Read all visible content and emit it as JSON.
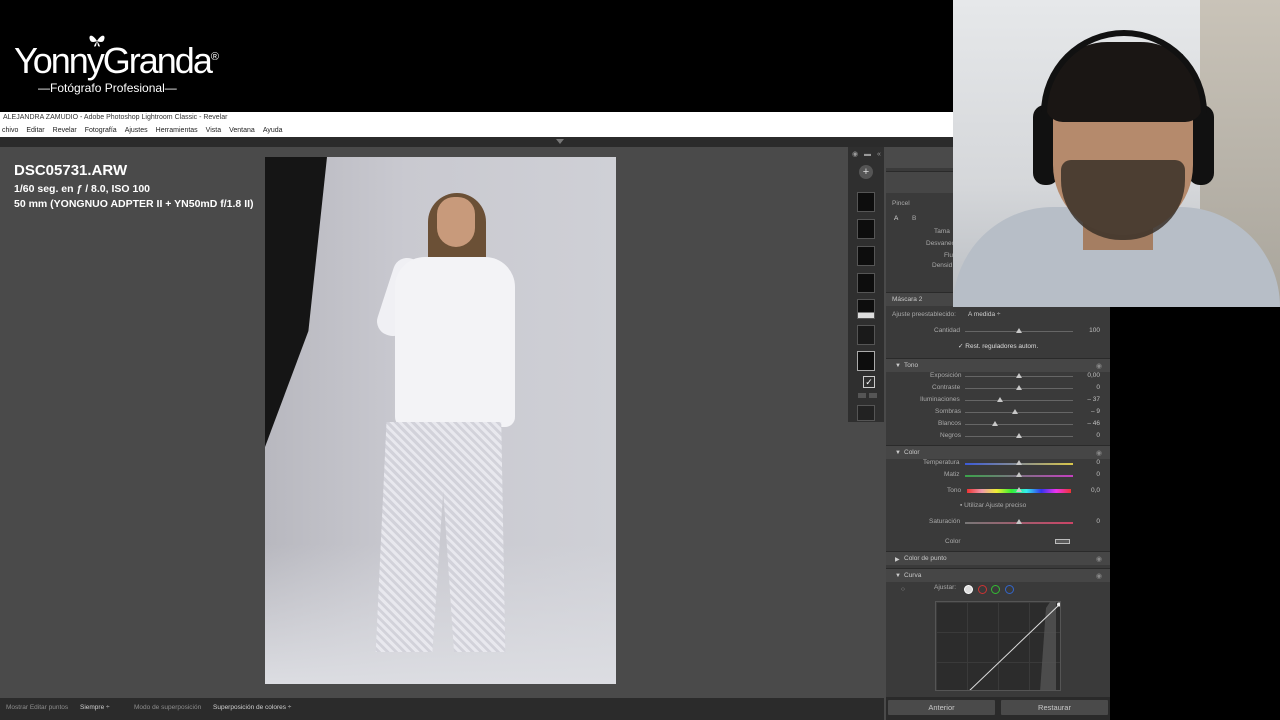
{
  "brand": {
    "name": "YonnyGranda",
    "reg": "®",
    "subtitle": "—Fotógrafo Profesional—"
  },
  "window": {
    "title": "ALEJANDRA ZAMUDIO - Adobe Photoshop Lightroom Classic - Revelar"
  },
  "menu": [
    "chivo",
    "Editar",
    "Revelar",
    "Fotografía",
    "Ajustes",
    "Herramientas",
    "Vista",
    "Ventana",
    "Ayuda"
  ],
  "photo_info": {
    "filename": "DSC05731.ARW",
    "exposure": "1/60 seg. en ƒ / 8.0, ISO 100",
    "lens": "50 mm (YONGNUO ADPTER II + YN50mD f/1.8 II)"
  },
  "panel": {
    "brush_label": "Pincel",
    "brush_a": "A",
    "brush_b": "B",
    "brush_rows": [
      "Tama",
      "Desvanec",
      "Flu",
      "Densid"
    ],
    "mask_label": "Máscara 2",
    "preset_label": "Ajuste preestablecido:",
    "preset_value": "A medida ÷",
    "amount_label": "Cantidad",
    "amount_value": "100",
    "reset_label": "Rest. reguladores autom.",
    "tone_section": "Tono",
    "tone": [
      {
        "label": "Exposición",
        "value": "0,00",
        "pos": 0.5
      },
      {
        "label": "Contraste",
        "value": "0",
        "pos": 0.5
      },
      {
        "label": "Iluminaciones",
        "value": "– 37",
        "pos": 0.32
      },
      {
        "label": "Sombras",
        "value": "– 9",
        "pos": 0.46
      },
      {
        "label": "Blancos",
        "value": "– 46",
        "pos": 0.28
      },
      {
        "label": "Negros",
        "value": "0",
        "pos": 0.5
      }
    ],
    "color_section": "Color",
    "temp_label": "Temperatura",
    "temp_value": "0",
    "tint_label": "Matiz",
    "tint_value": "0",
    "hue_label": "Tono",
    "hue_value": "0,0",
    "fine_adjust_label": "Utilizar Ajuste preciso",
    "sat_label": "Saturación",
    "sat_value": "0",
    "color_label": "Color",
    "point_color_section": "Color de punto",
    "curve_section": "Curva",
    "curve_adjust_label": "Ajustar:",
    "btn_prev": "Anterior",
    "btn_reset": "Restaurar"
  },
  "bottombar": {
    "show_edit_points": "Mostrar Editar puntos",
    "always": "Siempre ÷",
    "overlay_mode": "Modo de superposición",
    "overlay_value": "Superposición de colores ÷"
  }
}
